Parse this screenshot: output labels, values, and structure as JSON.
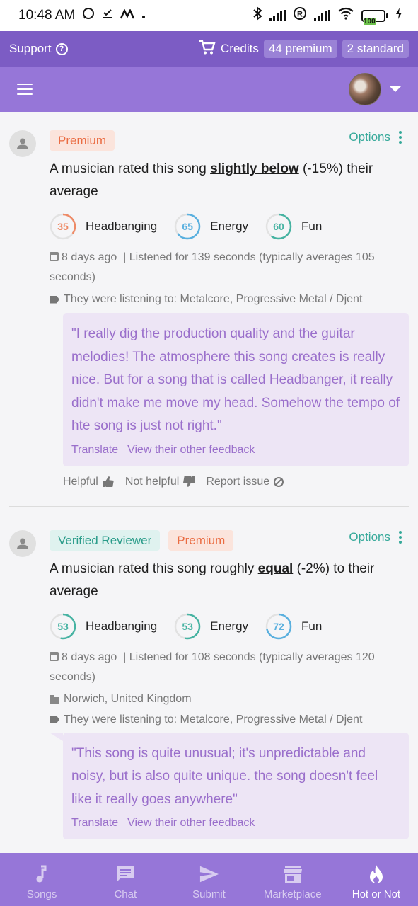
{
  "status": {
    "time": "10:48 AM",
    "battery": "100"
  },
  "header": {
    "support_label": "Support",
    "credits_label": "Credits",
    "premium_credits": "44 premium",
    "standard_credits": "2 standard"
  },
  "feedback": [
    {
      "badges": [
        "Premium"
      ],
      "options_label": "Options",
      "rating_prefix": "A musician rated this song ",
      "rating_emph": "slightly below",
      "rating_suffix": " (-15%) their average",
      "scores": [
        {
          "value": "35",
          "label": "Headbanging",
          "fraction": 0.35,
          "color": "#ee8a66"
        },
        {
          "value": "65",
          "label": "Energy",
          "fraction": 0.65,
          "color": "#5ab0df"
        },
        {
          "value": "60",
          "label": "Fun",
          "fraction": 0.6,
          "color": "#46b3a2"
        }
      ],
      "date": "8 days ago",
      "listened": "| Listened for 139 seconds (typically averages 105 seconds)",
      "location": "",
      "listening_to": "They were listening to: Metalcore, Progressive Metal / Djent",
      "quote": "\"I really dig the production quality and the guitar melodies! The atmosphere this song creates is really nice. But for a song that is called Headbanger, it really didn't make me move my head. Somehow the tempo of hte song is just not right.\"",
      "translate_label": "Translate",
      "other_feedback_label": "View their other feedback",
      "helpful_label": "Helpful",
      "not_helpful_label": "Not helpful",
      "report_label": "Report issue"
    },
    {
      "badges": [
        "Verified Reviewer",
        "Premium"
      ],
      "options_label": "Options",
      "rating_prefix": "A musician rated this song roughly ",
      "rating_emph": "equal",
      "rating_suffix": " (-2%) to their average",
      "scores": [
        {
          "value": "53",
          "label": "Headbanging",
          "fraction": 0.53,
          "color": "#46b3a2"
        },
        {
          "value": "53",
          "label": "Energy",
          "fraction": 0.53,
          "color": "#46b3a2"
        },
        {
          "value": "72",
          "label": "Fun",
          "fraction": 0.72,
          "color": "#5ab0df"
        }
      ],
      "date": "8 days ago",
      "listened": "| Listened for 108 seconds (typically averages 120 seconds)",
      "location": "Norwich, United Kingdom",
      "listening_to": "They were listening to: Metalcore, Progressive Metal / Djent",
      "quote": "\"This song is quite unusual; it's unpredictable and noisy, but is also quite unique. the song doesn't feel like it really goes anywhere\"",
      "translate_label": "Translate",
      "other_feedback_label": "View their other feedback"
    }
  ],
  "nav": [
    {
      "label": "Songs",
      "icon": "music-note-icon"
    },
    {
      "label": "Chat",
      "icon": "chat-icon"
    },
    {
      "label": "Submit",
      "icon": "send-icon"
    },
    {
      "label": "Marketplace",
      "icon": "store-icon"
    },
    {
      "label": "Hot or Not",
      "icon": "flame-icon",
      "active": true
    }
  ],
  "colors": {
    "brand": "#7c5cc4",
    "accent": "#9676d8",
    "teal": "#36a99a",
    "quote_text": "#9a6fcb"
  }
}
